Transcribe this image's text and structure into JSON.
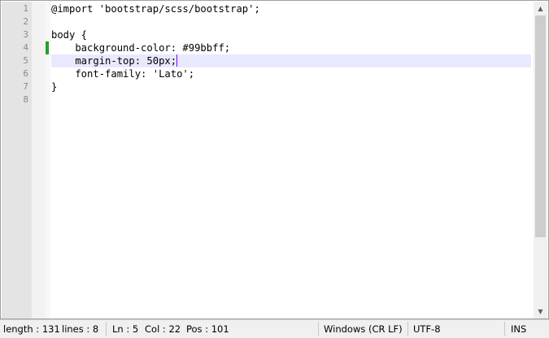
{
  "editor": {
    "lines": [
      {
        "number": "1",
        "text": "@import 'bootstrap/scss/bootstrap';"
      },
      {
        "number": "2",
        "text": ""
      },
      {
        "number": "3",
        "text": "body {"
      },
      {
        "number": "4",
        "text": "    background-color: #99bbff;"
      },
      {
        "number": "5",
        "text": "    margin-top: 50px;"
      },
      {
        "number": "6",
        "text": "    font-family: 'Lato';"
      },
      {
        "number": "7",
        "text": "}"
      },
      {
        "number": "8",
        "text": ""
      }
    ],
    "current_line_index": 4,
    "changed_line_index": 3,
    "colors": {
      "current_line": "#e8e8ff",
      "change_marker": "#2a9d2a",
      "caret": "#8000ff"
    }
  },
  "statusbar": {
    "length": "length : 131",
    "lines": "lines : 8",
    "ln": "Ln : 5",
    "col": "Col : 22",
    "pos": "Pos : 101",
    "eol": "Windows (CR LF)",
    "encoding": "UTF-8",
    "mode": "INS"
  },
  "scrollbar": {
    "up_icon": "triangle-up-icon",
    "down_icon": "triangle-down-icon"
  }
}
